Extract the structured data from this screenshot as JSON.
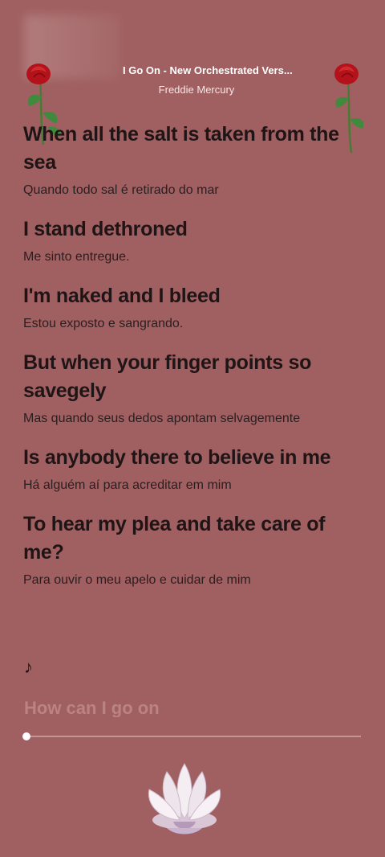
{
  "header": {
    "title": "I Go On - New Orchestrated Vers...",
    "artist": "Freddie Mercury"
  },
  "lyrics": [
    {
      "en": "When all the salt is taken from the sea",
      "pt": "Quando todo sal é retirado do mar"
    },
    {
      "en": "I stand dethroned",
      "pt": "Me sinto entregue."
    },
    {
      "en": "I'm naked and I bleed",
      "pt": "Estou exposto e sangrando."
    },
    {
      "en": "But when your finger points so savegely",
      "pt": "Mas quando seus dedos apontam selvagemente"
    },
    {
      "en": "Is anybody there to believe in me",
      "pt": "Há alguém aí para acreditar em mim"
    },
    {
      "en": "To hear my plea and take care of me?",
      "pt": "Para ouvir o meu apelo e cuidar de mim"
    }
  ],
  "music_note": "♪",
  "next_line": "How can I go on",
  "progress": 0,
  "colors": {
    "background": "#a05f60",
    "rose": "#b3121b",
    "leaf": "#3f8a3c"
  },
  "icons": {
    "rose_left": "rose-icon",
    "rose_right": "rose-icon",
    "lotus": "lotus-flower-icon"
  }
}
